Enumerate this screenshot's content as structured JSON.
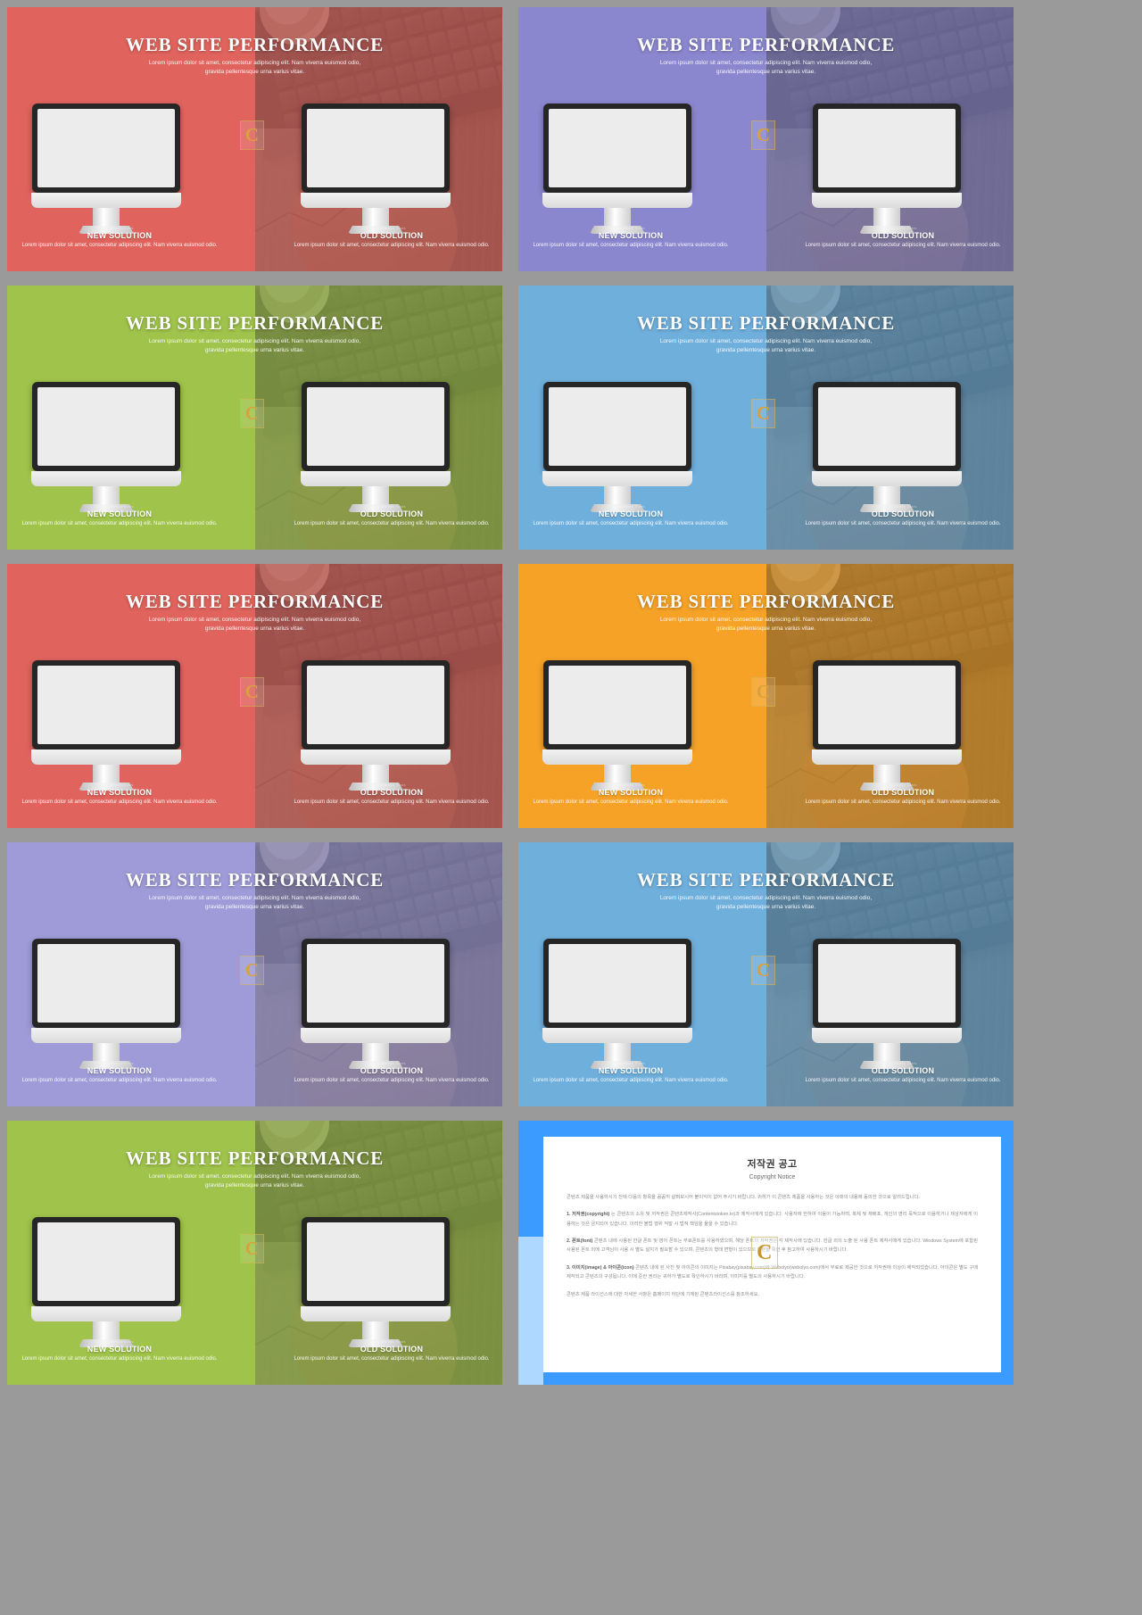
{
  "slide": {
    "title": "WEB SITE PERFORMANCE",
    "subtitle": "Lorem ipsum dolor sit amet, consectetur adipiscing elit. Nam viverra euismod odio, gravida pellentesque urna varius vitae.",
    "new_label": "NEW SOLUTION",
    "new_body": "Lorem ipsum dolor sit amet, consectetur adipiscing elit. Nam viverra euismod odio.",
    "old_label": "OLD SOLUTION",
    "old_body": "Lorem ipsum dolor sit amet, consectetur adipiscing elit. Nam viverra euismod odio.",
    "micro_label": "Business Stats",
    "badge_letter": "C"
  },
  "thumbnails": [
    {
      "index": 1,
      "accent": "#e0645d",
      "name": "red"
    },
    {
      "index": 2,
      "accent": "#8b87cf",
      "name": "purple"
    },
    {
      "index": 3,
      "accent": "#9fc34b",
      "name": "green"
    },
    {
      "index": 4,
      "accent": "#6fafdc",
      "name": "blue"
    },
    {
      "index": 5,
      "accent": "#e0645d",
      "name": "red"
    },
    {
      "index": 6,
      "accent": "#f5a227",
      "name": "orange"
    },
    {
      "index": 7,
      "accent": "#9f9bd8",
      "name": "lavender"
    },
    {
      "index": 8,
      "accent": "#6fafdc",
      "name": "blue"
    },
    {
      "index": 9,
      "accent": "#9fc34b",
      "name": "green"
    }
  ],
  "copyright": {
    "title_ko": "저작권 공고",
    "title_en": "Copyright Notice",
    "intro": "콘텐츠 제품을 사용하시기 전에 다음의 항목을 꼼꼼히 살펴보시어 불이익이 없어 주시기 바랍니다. 귀하가 이 콘텐츠 제품을 사용하는 것은 아래의 내용에 동의한 것으로 알려드립니다.",
    "sections": [
      {
        "heading": "1. 저작권(copyright)",
        "body": "는 콘텐츠의 소유 및 저작권은 콘텐츠제작사(Contentstoken.kr)과 제작사에게 있습니다. 사용자에 한하여 이용이 가능하며, 복제 및 재배포, 개인의 영리 목적으로 이용하거나 제삼자에게 이용하는 것은 금지되어 있습니다. 이러한 불법 행위 적발 시 법적 책임을 물을 수 있습니다."
      },
      {
        "heading": "2. 폰트(font)",
        "body": "콘텐츠 내에 사용된 한글 폰트 및 영어 폰트는 무료폰트를 사용하였으며, 해당 폰트의 저작권은 각 제작사에 있습니다. 한글 외의 노출 된 사용 폰트 제작사에게 있습니다. Windows System에 포함된 사용된 폰트 외에 고객님이 사용 시 별도 설치가 필요할 수 있으며, 콘텐츠의 형태 변형이 있으므로 원본을 확인 후 참고하여 사용하시기 바랍니다."
      },
      {
        "heading": "3. 이미지(image) & 아이콘(icon)",
        "body": "콘텐츠 내에 된 사진 및 아이콘의 이미지는 Pixabay(pixabay.com)와 Webolyo(webolyo.com)에서 무료로 제공한 것으로 저작권에 이상이 제작되었습니다. 아이콘은 별도 구매 제작되고 콘텐츠의 구성됩니다. 이에 준한 권리는 귀하가 별도로 확인하시기 바라며, 이미지를 별도의 사용하시기 바랍니다."
      }
    ],
    "footer": "콘텐츠 제품 라이선스에 대한 자세한 사항은 홈페이지 하단에 기재된 콘텐츠라이선스를 참조하세요."
  }
}
